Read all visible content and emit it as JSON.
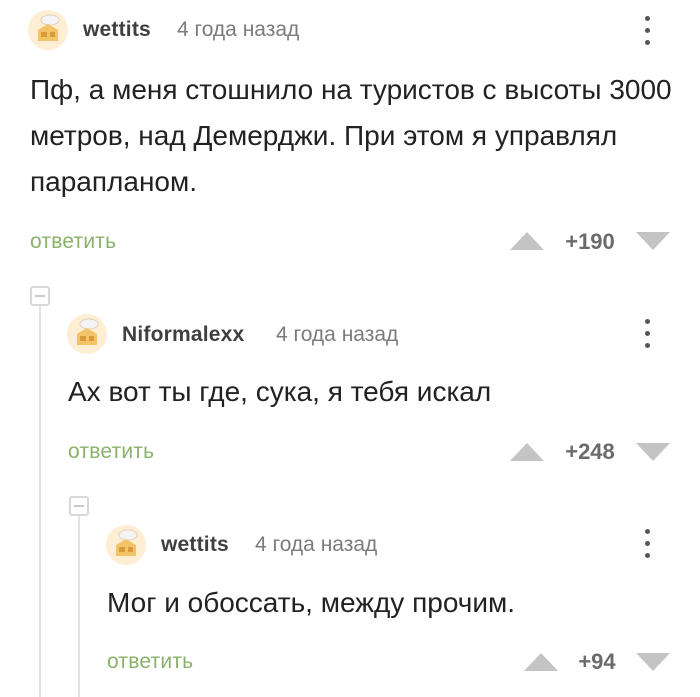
{
  "comments": [
    {
      "username": "wettits",
      "time": "4 года назад",
      "text": "Пф, а меня стошнило на туристов с высоты 3000 метров, над Демерджи. При этом я управлял парапланом.",
      "reply_label": "ответить",
      "score": "+190"
    },
    {
      "username": "Niformalexx",
      "time": "4 года назад",
      "text": "Ах вот ты где, сука, я тебя искал",
      "reply_label": "ответить",
      "score": "+248"
    },
    {
      "username": "wettits",
      "time": "4 года назад",
      "text": "Мог и обоссать, между прочим.",
      "reply_label": "ответить",
      "score": "+94"
    }
  ],
  "colors": {
    "reply_link": "#8ab26b",
    "vote_arrow": "#c4c4c4",
    "thread_line": "#e2e2e2"
  },
  "icons": {
    "avatar": "default-avatar-icon",
    "menu": "more-vertical-icon",
    "upvote": "triangle-up-icon",
    "downvote": "triangle-down-icon",
    "collapse": "collapse-minus-icon"
  }
}
